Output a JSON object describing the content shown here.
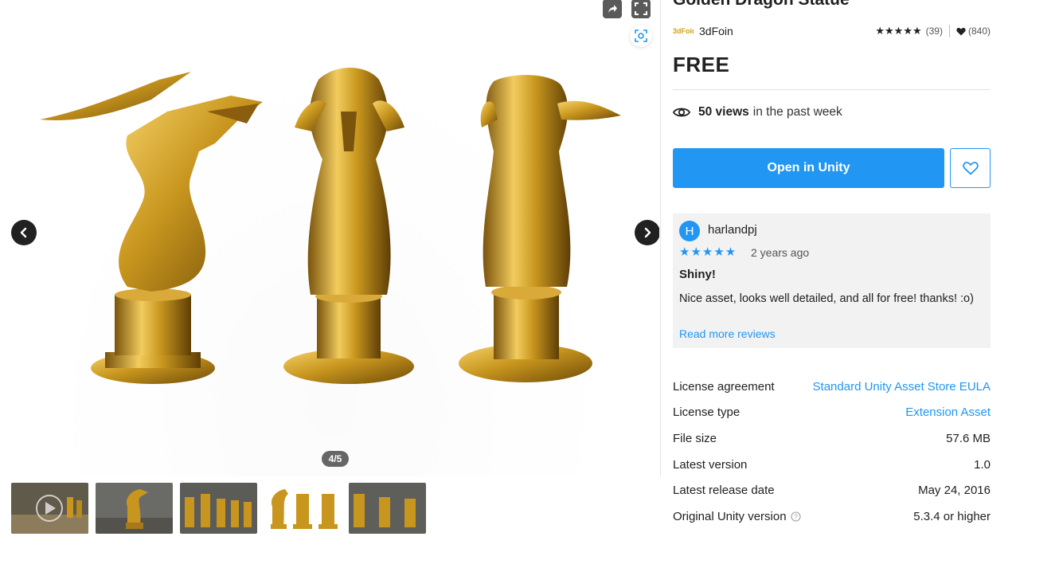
{
  "product": {
    "title": "Golden Dragon Statue",
    "publisher": "3dFoin",
    "rating_count": "(39)",
    "favorites": "(840)",
    "price": "FREE",
    "views_count": "50 views",
    "views_suffix": "in the past week",
    "open_button": "Open in Unity"
  },
  "gallery": {
    "counter": "4/5",
    "thumbnail_count": 5,
    "current_index": 4
  },
  "review": {
    "avatar_letter": "H",
    "reviewer": "harlandpj",
    "stars": "★★★★★",
    "date": "2 years ago",
    "title": "Shiny!",
    "body": "Nice asset, looks well detailed, and all for free! thanks! :o)",
    "read_more": "Read more reviews"
  },
  "details": [
    {
      "label": "License agreement",
      "value": "Standard Unity Asset Store EULA",
      "link": true
    },
    {
      "label": "License type",
      "value": "Extension Asset",
      "link": true
    },
    {
      "label": "File size",
      "value": "57.6 MB",
      "link": false
    },
    {
      "label": "Latest version",
      "value": "1.0",
      "link": false
    },
    {
      "label": "Latest release date",
      "value": "May 24, 2016",
      "link": false
    },
    {
      "label": "Original Unity version",
      "value": "5.3.4 or higher",
      "link": false,
      "help_icon": true
    }
  ],
  "colors": {
    "accent": "#2196f3",
    "gold": "#c8961e",
    "text": "#212121"
  },
  "icons": [
    "share-icon",
    "fullscreen-icon",
    "ar-view-icon",
    "chevron-left-icon",
    "chevron-right-icon",
    "eye-icon",
    "heart-icon",
    "help-icon",
    "star-icon"
  ]
}
